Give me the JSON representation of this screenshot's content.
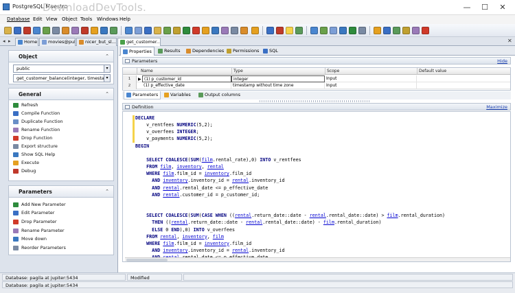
{
  "window": {
    "title": "PostgreSQL Maestro",
    "watermark": "DownloadDevTools."
  },
  "menu": [
    "Database",
    "Edit",
    "View",
    "Object",
    "Tools",
    "Windows",
    "Help"
  ],
  "doc_tabs": [
    {
      "label": "Home",
      "color": "#4a86d0"
    },
    {
      "label": "movies@public",
      "color": "#7c9ed6"
    },
    {
      "label": "nicer_but_sl...",
      "color": "#d98c2b"
    },
    {
      "label": "get_customer...",
      "color": "#4aa04a"
    }
  ],
  "left": {
    "object": {
      "title": "Object",
      "schema": "public",
      "function": "get_customer_balance(integer, timestamp"
    },
    "general": {
      "title": "General",
      "actions": [
        {
          "label": "Refresh",
          "icon": "refresh-icon",
          "color": "#2e8b3c"
        },
        {
          "label": "Compile Function",
          "icon": "compile-icon",
          "color": "#3a6fc4"
        },
        {
          "label": "Duplicate Function",
          "icon": "duplicate-icon",
          "color": "#6a8fc8"
        },
        {
          "label": "Rename Function",
          "icon": "rename-icon",
          "color": "#9a7ab8"
        },
        {
          "label": "Drop Function",
          "icon": "drop-icon",
          "color": "#d03a2a"
        },
        {
          "label": "Export structure",
          "icon": "export-icon",
          "color": "#7a8aa3"
        },
        {
          "label": "Show SQL Help",
          "icon": "help-icon",
          "color": "#3a78c0"
        },
        {
          "label": "Execute",
          "icon": "execute-icon",
          "color": "#e5a020"
        },
        {
          "label": "Debug",
          "icon": "debug-icon",
          "color": "#c0392b"
        }
      ]
    },
    "parameters": {
      "title": "Parameters",
      "actions": [
        {
          "label": "Add New Parameter",
          "icon": "add-parameter-icon",
          "color": "#2e8b3c"
        },
        {
          "label": "Edit Parameter",
          "icon": "edit-parameter-icon",
          "color": "#3a6fc4"
        },
        {
          "label": "Drop Parameter",
          "icon": "drop-parameter-icon",
          "color": "#d03a2a"
        },
        {
          "label": "Rename Parameter",
          "icon": "rename-parameter-icon",
          "color": "#9a7ab8"
        },
        {
          "label": "Move down",
          "icon": "move-down-icon",
          "color": "#3a78c0"
        },
        {
          "label": "Reorder Parameters",
          "icon": "reorder-icon",
          "color": "#7a8aa3"
        }
      ]
    }
  },
  "sub_tabs": [
    {
      "label": "Properties",
      "color": "#4a86d0"
    },
    {
      "label": "Results",
      "color": "#5a9a5a"
    },
    {
      "label": "Dependencies",
      "color": "#d98c2b"
    },
    {
      "label": "Permissions",
      "color": "#c0a030"
    },
    {
      "label": "SQL",
      "color": "#3a6fc4"
    }
  ],
  "parameters_panel": {
    "title": "Parameters",
    "hide": "Hide",
    "columns": [
      "Name",
      "Type",
      "Scope",
      "Default value"
    ],
    "rows": [
      {
        "num": "1",
        "name": "(1) p_customer_id",
        "type": "integer",
        "scope": "Input",
        "default": ""
      },
      {
        "num": "2",
        "name": "(1) p_effective_date",
        "type": "timestamp without time zone",
        "scope": "Input",
        "default": ""
      }
    ],
    "tabs": [
      "Parameters",
      "Variables",
      "Output columns"
    ]
  },
  "definition": {
    "title": "Definition",
    "maximize": "Maximize"
  },
  "status": {
    "db1": "Database: pagila at jupiter:5434",
    "modified": "Modified",
    "db2": "Database: pagila at jupiter:5434"
  }
}
